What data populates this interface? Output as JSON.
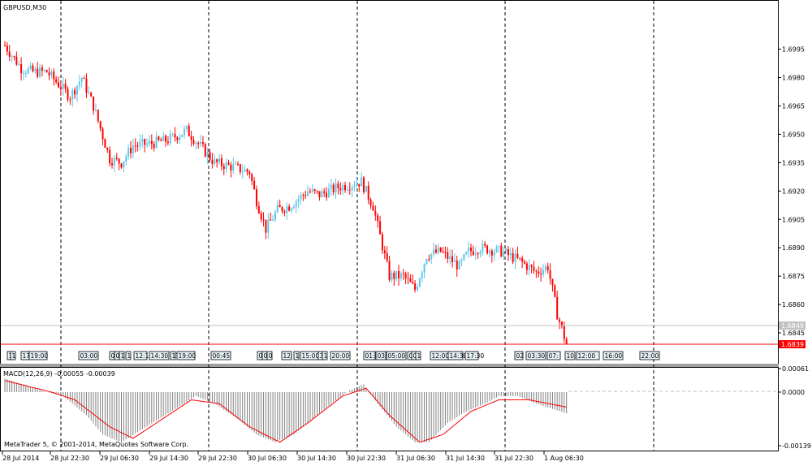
{
  "window": {
    "symbol_label": "GBPUSD,M30",
    "macd_label": "MACD(12,26,9) -0.00055 -0.00039",
    "copyright": "MetaTrader 5, © 2001-2014, MetaQuotes Software Corp."
  },
  "colors": {
    "bull": "#5bc8e8",
    "bear": "#ff0000",
    "macd_hist": "#808080",
    "signal": "#ff0000",
    "grid": "#000000",
    "ask_line": "#c0c0c0",
    "current_price_bg": "#ff0000"
  },
  "price_axis": {
    "ticks": [
      "1.6995",
      "1.6980",
      "1.6965",
      "1.6950",
      "1.6935",
      "1.6920",
      "1.6905",
      "1.6890",
      "1.6875",
      "1.6860",
      "1.6845"
    ],
    "ask_label": "1.6849",
    "current_label": "1.6839"
  },
  "macd_axis": {
    "ticks": [
      "0.00061",
      "0.0000",
      "-0.00139"
    ]
  },
  "time_axis": {
    "labels": [
      "28 Jul 2014",
      "28 Jul 22:30",
      "29 Jul 06:30",
      "29 Jul 14:30",
      "29 Jul 22:30",
      "30 Jul 06:30",
      "30 Jul 14:30",
      "30 Jul 22:30",
      "31 Jul 06:30",
      "31 Jul 14:30",
      "31 Jul 22:30",
      "1 Aug 06:30"
    ]
  },
  "events": [
    {
      "text": "1"
    },
    {
      "text": "1"
    },
    {
      "text": "17"
    },
    {
      "text": "19:00"
    },
    {
      "text": "03:00"
    },
    {
      "text": "0"
    },
    {
      "text": "0"
    },
    {
      "text": "1"
    },
    {
      "text": "1"
    },
    {
      "text": "12:1"
    },
    {
      "text": "14:30"
    },
    {
      "text": "17"
    },
    {
      "text": "19:00"
    },
    {
      "text": "00:45"
    },
    {
      "text": "0"
    },
    {
      "text": "0"
    },
    {
      "text": "0"
    },
    {
      "text": "12:"
    },
    {
      "text": "1"
    },
    {
      "text": "15:00"
    },
    {
      "text": "3"
    },
    {
      "text": "1"
    },
    {
      "text": "20:00"
    },
    {
      "text": "01:"
    },
    {
      "text": "03"
    },
    {
      "text": "05:00"
    },
    {
      "text": "0"
    },
    {
      "text": "0"
    },
    {
      "text": "1"
    },
    {
      "text": "12:00"
    },
    {
      "text": "14:30"
    },
    {
      "text": "17:30"
    },
    {
      "text": "02"
    },
    {
      "text": "03:30"
    },
    {
      "text": "07:"
    },
    {
      "text": "10:"
    },
    {
      "text": "12:00"
    },
    {
      "text": "16:00"
    },
    {
      "text": "22:00"
    }
  ],
  "chart_data": [
    {
      "type": "candlestick",
      "title": "GBPUSD,M30",
      "ylim": [
        1.6839,
        1.7015
      ],
      "grid": "vertical dashed at day separators",
      "candles_count": 252,
      "path": [
        [
          0,
          1.6997
        ],
        [
          7,
          1.6985
        ],
        [
          12,
          1.6983
        ],
        [
          18,
          1.6983
        ],
        [
          28,
          1.697
        ],
        [
          33,
          1.698
        ],
        [
          38,
          1.6965
        ],
        [
          45,
          1.6937
        ],
        [
          50,
          1.6935
        ],
        [
          55,
          1.6944
        ],
        [
          62,
          1.6945
        ],
        [
          70,
          1.6947
        ],
        [
          78,
          1.6952
        ],
        [
          83,
          1.6945
        ],
        [
          90,
          1.6935
        ],
        [
          97,
          1.6933
        ],
        [
          105,
          1.693
        ],
        [
          108,
          1.6915
        ],
        [
          112,
          1.69
        ],
        [
          117,
          1.691
        ],
        [
          122,
          1.6912
        ],
        [
          130,
          1.692
        ],
        [
          135,
          1.6918
        ],
        [
          143,
          1.6922
        ],
        [
          153,
          1.6925
        ],
        [
          158,
          1.6912
        ],
        [
          165,
          1.6875
        ],
        [
          171,
          1.6875
        ],
        [
          176,
          1.6868
        ],
        [
          181,
          1.6886
        ],
        [
          187,
          1.6888
        ],
        [
          195,
          1.688
        ],
        [
          199,
          1.6888
        ],
        [
          204,
          1.689
        ],
        [
          213,
          1.6888
        ],
        [
          221,
          1.6883
        ],
        [
          228,
          1.6877
        ],
        [
          233,
          1.688
        ],
        [
          237,
          1.6855
        ],
        [
          241,
          1.6839
        ]
      ],
      "last_close": 1.6839
    },
    {
      "type": "bar",
      "title": "MACD(12,26,9) -0.00055 -0.00039",
      "ylim": [
        -0.00139,
        0.00061
      ],
      "macd_path": [
        [
          0,
          0.00035
        ],
        [
          18,
          0.0
        ],
        [
          25,
          -0.0001
        ],
        [
          35,
          -0.0006
        ],
        [
          42,
          -0.0011
        ],
        [
          50,
          -0.0013
        ],
        [
          58,
          -0.001
        ],
        [
          66,
          -0.0007
        ],
        [
          74,
          -0.0004
        ],
        [
          82,
          -0.0001
        ],
        [
          90,
          -0.0003
        ],
        [
          100,
          -0.0007
        ],
        [
          108,
          -0.0011
        ],
        [
          116,
          -0.0013
        ],
        [
          124,
          -0.0011
        ],
        [
          132,
          -0.0007
        ],
        [
          140,
          -0.0003
        ],
        [
          148,
          5e-05
        ],
        [
          154,
          0.0002
        ],
        [
          160,
          -0.0003
        ],
        [
          168,
          -0.0009
        ],
        [
          176,
          -0.0013
        ],
        [
          182,
          -0.0013
        ],
        [
          190,
          -0.0008
        ],
        [
          198,
          -0.0005
        ],
        [
          206,
          -0.0003
        ],
        [
          212,
          -0.0001
        ],
        [
          220,
          -0.0001
        ],
        [
          228,
          -0.0003
        ],
        [
          241,
          -0.00055
        ]
      ],
      "signal_path": [
        [
          0,
          0.0003
        ],
        [
          20,
          0.0
        ],
        [
          30,
          -0.0002
        ],
        [
          45,
          -0.0009
        ],
        [
          55,
          -0.0012
        ],
        [
          65,
          -0.0008
        ],
        [
          80,
          -0.0002
        ],
        [
          92,
          -0.0003
        ],
        [
          105,
          -0.0009
        ],
        [
          118,
          -0.0013
        ],
        [
          130,
          -0.0008
        ],
        [
          145,
          -0.0001
        ],
        [
          155,
          0.0001
        ],
        [
          165,
          -0.0006
        ],
        [
          178,
          -0.0013
        ],
        [
          188,
          -0.0011
        ],
        [
          200,
          -0.0005
        ],
        [
          212,
          -0.0002
        ],
        [
          225,
          -0.0002
        ],
        [
          241,
          -0.00039
        ]
      ]
    }
  ]
}
